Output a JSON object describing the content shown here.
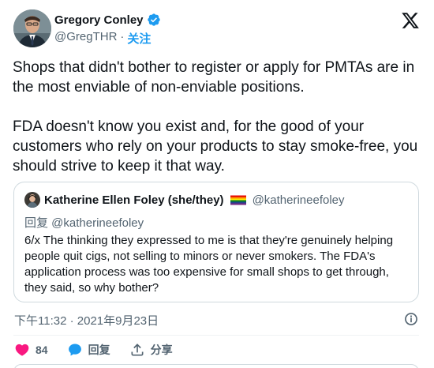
{
  "author": {
    "name": "Gregory Conley",
    "handle": "@GregTHR",
    "separator": "·",
    "follow_label": "关注"
  },
  "tweet": {
    "paragraphs": [
      "Shops that didn't bother to register or apply for PMTAs are in the most enviable of non-enviable positions.",
      "FDA doesn't know you exist and, for the good of your customers who rely on your products to stay smoke-free, you should strive to keep it that way."
    ]
  },
  "quote": {
    "name": "Katherine Ellen Foley (she/they)",
    "handle": "@katherineefoley",
    "reply_to": "回复 @katherineefoley",
    "text": "6/x The thinking they expressed to me is that they're genuinely helping people quit cigs, not selling to minors or never smokers. The FDA's application process was too expensive for small shops to get through, they said, so why bother?"
  },
  "timestamp": "下午11:32 · 2021年9月23日",
  "actions": {
    "like_count": "84",
    "reply_label": "回复",
    "share_label": "分享"
  },
  "colors": {
    "like": "#f91880",
    "reply": "#1d9bf0",
    "follow": "#1d9bf0",
    "verified": "#1d9bf0"
  },
  "icons": [
    "verified-badge-icon",
    "x-logo-icon",
    "rainbow-flag-icon",
    "info-icon",
    "heart-icon",
    "reply-bubble-icon",
    "share-icon"
  ]
}
